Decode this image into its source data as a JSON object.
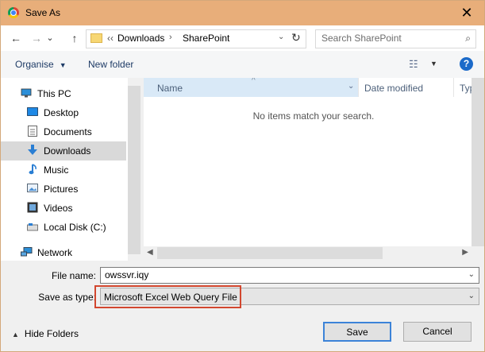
{
  "window": {
    "title": "Save As",
    "close_glyph": "✕"
  },
  "nav": {
    "back_glyph": "←",
    "forward_glyph": "→",
    "recent_glyph": "⌄",
    "up_glyph": "↑",
    "address": {
      "overflow": "‹‹",
      "crumbs": [
        "Downloads",
        "SharePoint"
      ],
      "separator": "›",
      "dropdown_glyph": "⌄",
      "refresh_glyph": "↻"
    },
    "search_placeholder": "Search SharePoint",
    "search_glyph": "⌕"
  },
  "toolbar": {
    "organise_label": "Organise",
    "organise_caret": "▼",
    "new_folder_label": "New folder",
    "view_glyph": "☷",
    "view_caret": "▼",
    "help_glyph": "?"
  },
  "sidebar": {
    "items": [
      {
        "label": "This PC",
        "icon": "computer-icon"
      },
      {
        "label": "Desktop",
        "icon": "desktop-icon"
      },
      {
        "label": "Documents",
        "icon": "documents-icon"
      },
      {
        "label": "Downloads",
        "icon": "downloads-icon",
        "selected": true
      },
      {
        "label": "Music",
        "icon": "music-icon"
      },
      {
        "label": "Pictures",
        "icon": "pictures-icon"
      },
      {
        "label": "Videos",
        "icon": "videos-icon"
      },
      {
        "label": "Local Disk (C:)",
        "icon": "disk-icon"
      },
      {
        "label": "Network",
        "icon": "network-icon"
      }
    ]
  },
  "filelist": {
    "columns": [
      "Name",
      "Date modified",
      "Type"
    ],
    "sort_glyph": "^",
    "column_dropdown_glyph": "⌄",
    "empty_message": "No items match your search."
  },
  "scroll": {
    "left_glyph": "◀",
    "right_glyph": "▶"
  },
  "form": {
    "filename_label": "File name:",
    "filename_value": "owssvr.iqy",
    "type_label": "Save as type:",
    "type_value": "Microsoft Excel Web Query File",
    "dropdown_glyph": "⌄"
  },
  "footer": {
    "hide_folders_caret": "▲",
    "hide_folders_label": "Hide Folders",
    "save_label": "Save",
    "cancel_label": "Cancel"
  },
  "colors": {
    "titlebar": "#e8ae7a",
    "header_highlight": "#d9e9f7",
    "selected_item": "#d9d9d9",
    "annotation_box": "#d2472f",
    "default_button_border": "#3c83d8"
  }
}
